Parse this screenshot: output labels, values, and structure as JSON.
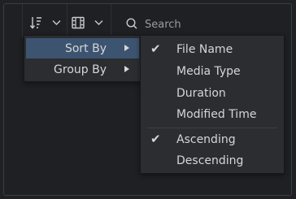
{
  "toolbar": {
    "sort_icon": "sort-descending-icon",
    "view_icon": "film-grid-icon",
    "search_placeholder": "Search"
  },
  "main_menu": {
    "items": [
      {
        "label": "Sort By",
        "active": true,
        "has_submenu": true
      },
      {
        "label": "Group By",
        "active": false,
        "has_submenu": true
      }
    ]
  },
  "sort_menu": {
    "fields": [
      {
        "label": "File Name",
        "checked": true
      },
      {
        "label": "Media Type",
        "checked": false
      },
      {
        "label": "Duration",
        "checked": false
      },
      {
        "label": "Modified Time",
        "checked": false
      }
    ],
    "order": [
      {
        "label": "Ascending",
        "checked": true
      },
      {
        "label": "Descending",
        "checked": false
      }
    ],
    "check_glyph": "✔"
  },
  "colors": {
    "background": "#1e2023",
    "menu_bg": "#2b2d31",
    "highlight": "#3d5471",
    "text": "#d4d6d8"
  }
}
